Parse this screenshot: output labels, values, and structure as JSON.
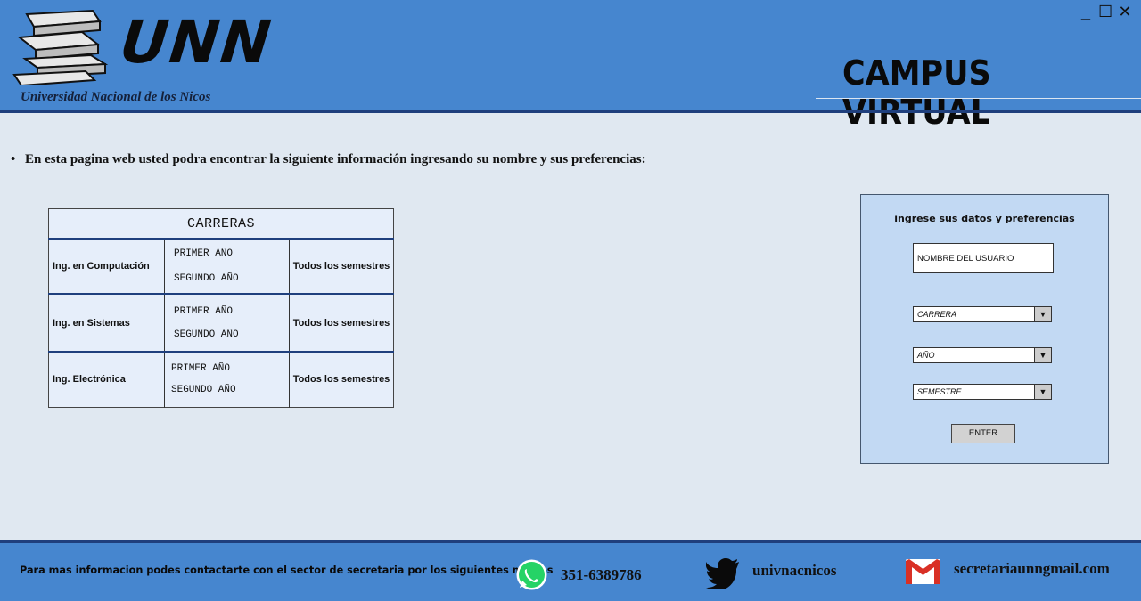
{
  "header": {
    "logo_text": "UNN",
    "university_name": "Universidad Nacional de los Nicos",
    "campus_title": "CAMPUS VIRTUAL"
  },
  "window_controls": {
    "minimize": "_",
    "maximize": "☐",
    "close": "✕"
  },
  "intro": {
    "bullet": "•",
    "text": "En esta pagina web usted podra encontrar la siguiente información ingresando su nombre y sus preferencias:"
  },
  "careers_table": {
    "title": "CARRERAS",
    "rows": [
      {
        "career": "Ing. en Computación",
        "years": [
          "PRIMER AÑO",
          "SEGUNDO AÑO"
        ],
        "semesters": "Todos los semestres"
      },
      {
        "career": "Ing. en Sistemas",
        "years": [
          "PRIMER AÑO",
          "SEGUNDO AÑO"
        ],
        "semesters": "Todos los semestres"
      },
      {
        "career": "Ing. Electrónica",
        "years": [
          "PRIMER AÑO",
          "SEGUNDO AÑO"
        ],
        "semesters": "Todos los semestres"
      }
    ]
  },
  "form": {
    "title": "ingrese sus datos y preferencias",
    "name_value": "NOMBRE DEL USUARIO",
    "career_select": "CARRERA",
    "year_select": "AÑO",
    "semester_select": "SEMESTRE",
    "enter_label": "ENTER"
  },
  "footer": {
    "text": "Para mas informacion podes contactarte con el sector de secretaria por los siguientes medios",
    "whatsapp": "351-6389786",
    "twitter": "univnacnicos",
    "email": "secretariaunngmail.com"
  },
  "colors": {
    "header_bg": "#4686cf",
    "page_bg": "#e0e8f1",
    "form_bg": "#c2d9f3",
    "accent_dark": "#1f3f7d",
    "whatsapp_green": "#25d366",
    "gmail_red": "#d93025"
  }
}
